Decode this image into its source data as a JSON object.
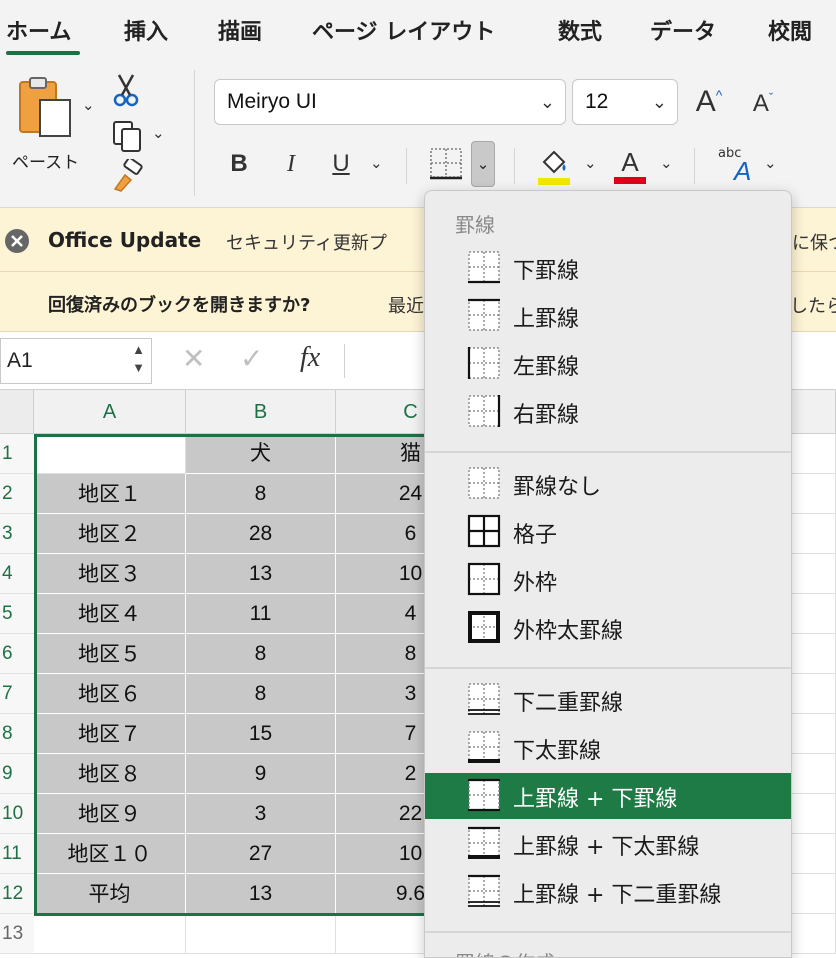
{
  "ribbon_tabs": [
    "ホーム",
    "挿入",
    "描画",
    "ページ レイアウト",
    "数式",
    "データ",
    "校閲"
  ],
  "ribbon": {
    "paste_label": "ペースト",
    "font_name": "Meiryo UI",
    "font_size": "12",
    "bold": "B",
    "italic": "I",
    "underline": "U",
    "font_color_letter": "A",
    "abc": "abc",
    "fill_color": "#f2e600",
    "font_color": "#e0001b"
  },
  "message_bar": {
    "title": "Office Update",
    "text": "セキュリティ更新プ",
    "text_right": "に保つ",
    "recovery_question": "回復済みのブックを開きますか?",
    "recovery_text": "最近",
    "recovery_right": "したら"
  },
  "formula_bar": {
    "name_box": "A1",
    "cancel": "✕",
    "enter": "✓",
    "fx": "fx"
  },
  "sheet": {
    "columns": [
      "A",
      "B",
      "C"
    ],
    "row_numbers": [
      "1",
      "2",
      "3",
      "4",
      "5",
      "6",
      "7",
      "8",
      "9",
      "10",
      "11",
      "12",
      "13"
    ],
    "rows": [
      [
        "",
        "犬",
        "猫"
      ],
      [
        "地区１",
        "8",
        "24"
      ],
      [
        "地区２",
        "28",
        "6"
      ],
      [
        "地区３",
        "13",
        "10"
      ],
      [
        "地区４",
        "11",
        "4"
      ],
      [
        "地区５",
        "8",
        "8"
      ],
      [
        "地区６",
        "8",
        "3"
      ],
      [
        "地区７",
        "15",
        "7"
      ],
      [
        "地区８",
        "9",
        "2"
      ],
      [
        "地区９",
        "3",
        "22"
      ],
      [
        "地区１０",
        "27",
        "10"
      ],
      [
        "平均",
        "13",
        "9.6"
      ]
    ],
    "accent_color": "#1e7145"
  },
  "border_menu": {
    "header": "罫線",
    "footer_header": "罫線の作成",
    "groups": [
      [
        {
          "icon": "bottom-border-icon",
          "label": "下罫線"
        },
        {
          "icon": "top-border-icon",
          "label": "上罫線"
        },
        {
          "icon": "left-border-icon",
          "label": "左罫線"
        },
        {
          "icon": "right-border-icon",
          "label": "右罫線"
        }
      ],
      [
        {
          "icon": "no-border-icon",
          "label": "罫線なし"
        },
        {
          "icon": "all-borders-icon",
          "label": "格子"
        },
        {
          "icon": "outside-borders-icon",
          "label": "外枠"
        },
        {
          "icon": "thick-box-border-icon",
          "label": "外枠太罫線"
        }
      ],
      [
        {
          "icon": "bottom-double-border-icon",
          "label": "下二重罫線"
        },
        {
          "icon": "thick-bottom-border-icon",
          "label": "下太罫線"
        },
        {
          "icon": "top-and-bottom-border-icon",
          "label": "上罫線 + 下罫線",
          "selected": true
        },
        {
          "icon": "top-and-thick-bottom-border-icon",
          "label": "上罫線 + 下太罫線"
        },
        {
          "icon": "top-and-double-bottom-border-icon",
          "label": "上罫線 + 下二重罫線"
        }
      ]
    ],
    "selected_color": "#1e7b45"
  }
}
